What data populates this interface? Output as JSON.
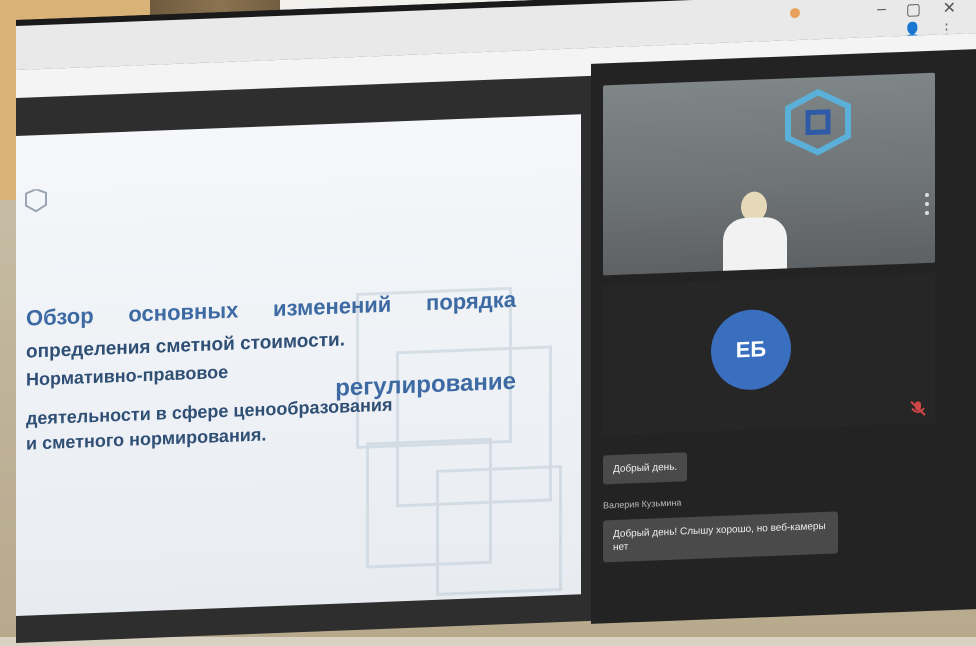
{
  "slide": {
    "heading_line1": [
      "Обзор",
      "основных",
      "изменений",
      "порядка"
    ],
    "heading_line2": "определения сметной стоимости.",
    "heading_line3": "Нормативно-правовое",
    "heading_line4": "регулирование",
    "heading_line5": "деятельности в сфере ценообразования",
    "heading_line6": "и сметного нормирования."
  },
  "participant": {
    "initials": "ЕБ"
  },
  "chat": {
    "message1": "Добрый день.",
    "sender2": "Валерия Кузьмина",
    "message2": "Добрый день! Слышу хорошо, но веб-камеры нет"
  },
  "colors": {
    "avatar": "#3a6fc0",
    "slide_text": "#355b8a",
    "panel_bg": "#232323"
  },
  "icons": [
    "camera-icon",
    "minimize-icon",
    "maximize-icon",
    "close-icon",
    "profile-icon",
    "menu-icon",
    "mic-off-icon",
    "org-logo-icon"
  ]
}
